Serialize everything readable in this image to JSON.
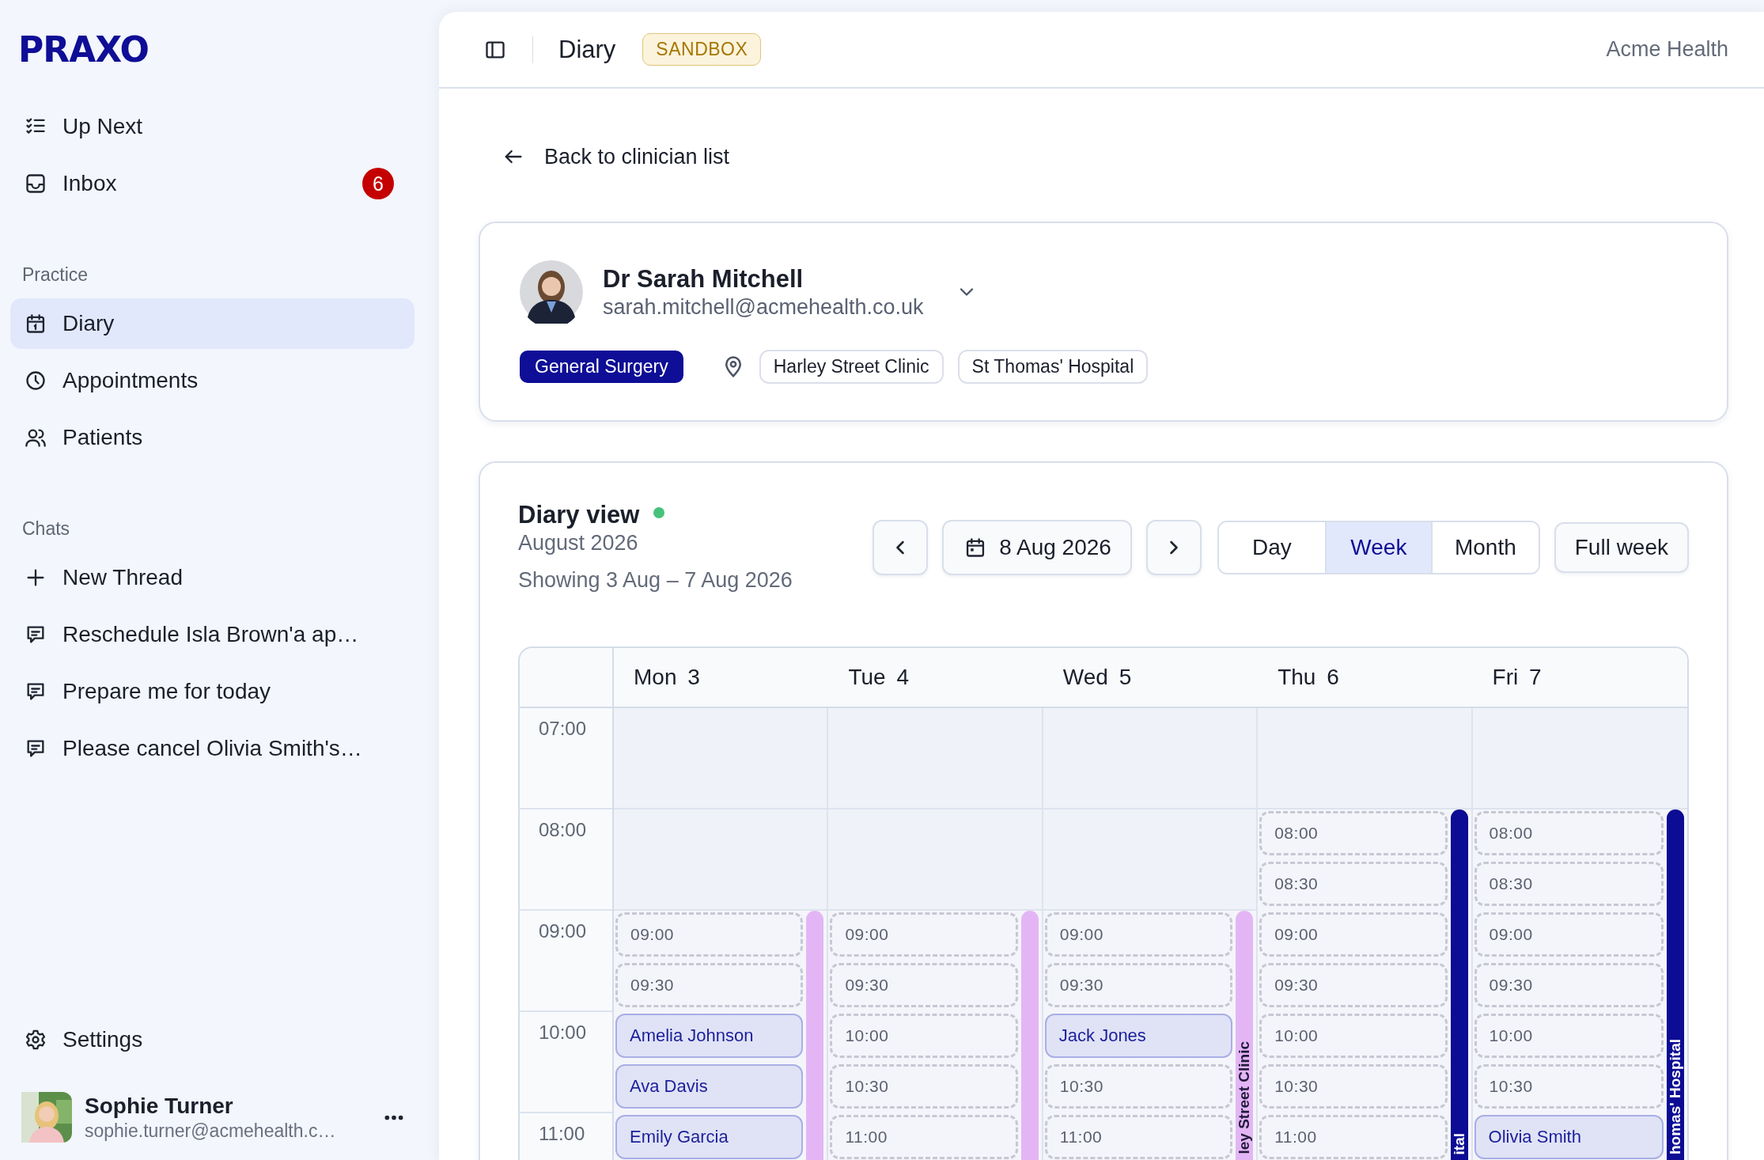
{
  "sidebar": {
    "logo": "PRAXO",
    "nav": [
      {
        "label": "Up Next",
        "kind": "checklist",
        "selected": false
      },
      {
        "label": "Inbox",
        "kind": "inbox",
        "badge": "6",
        "selected": false
      }
    ],
    "sections": [
      {
        "title": "Practice",
        "items": [
          {
            "label": "Diary",
            "kind": "calendar",
            "selected": true
          },
          {
            "label": "Appointments",
            "kind": "clock",
            "selected": false
          },
          {
            "label": "Patients",
            "kind": "users",
            "selected": false
          }
        ]
      },
      {
        "title": "Chats",
        "items": [
          {
            "label": "New Thread",
            "kind": "new",
            "selected": false
          },
          {
            "label": "Reschedule Isla Brown'a ap…",
            "kind": "chat",
            "selected": false
          },
          {
            "label": "Prepare me for today",
            "kind": "chat",
            "selected": false
          },
          {
            "label": "Please cancel Olivia Smith's…",
            "kind": "chat",
            "selected": false
          }
        ]
      }
    ],
    "settings": {
      "label": "Settings"
    },
    "user": {
      "name": "Sophie Turner",
      "email": "sophie.turner@acmehealth.c…"
    }
  },
  "header": {
    "title": "Diary",
    "badge": "SANDBOX",
    "org": "Acme Health"
  },
  "back_link": "Back to clinician list",
  "clinician": {
    "name": "Dr Sarah Mitchell",
    "email": "sarah.mitchell@acmehealth.co.uk",
    "specialty": "General Surgery",
    "locations": [
      "Harley Street Clinic",
      "St Thomas' Hospital"
    ]
  },
  "diary": {
    "title": "Diary view",
    "live": true,
    "month": "August 2026",
    "range": "Showing 3 Aug – 7 Aug 2026",
    "date": "8 Aug 2026",
    "views": [
      {
        "label": "Day",
        "selected": false
      },
      {
        "label": "Week",
        "selected": true
      },
      {
        "label": "Month",
        "selected": false
      }
    ],
    "full_week": "Full week",
    "hours": [
      "07:00",
      "08:00",
      "09:00",
      "10:00",
      "11:00"
    ],
    "days": [
      {
        "label": "Mon 3",
        "location_bar": {
          "color": "#e4b5f5"
        },
        "slots": [
          {
            "kind": "closed"
          },
          {
            "kind": "closed"
          },
          {
            "kind": "closed"
          },
          {
            "kind": "closed"
          },
          {
            "kind": "open",
            "time": "09:00"
          },
          {
            "kind": "open",
            "time": "09:30"
          },
          {
            "kind": "booked",
            "patient": "Amelia Johnson"
          },
          {
            "kind": "booked",
            "patient": "Ava Davis"
          },
          {
            "kind": "booked",
            "patient": "Emily Garcia"
          }
        ]
      },
      {
        "label": "Tue 4",
        "location_bar": {
          "color": "#e4b5f5"
        },
        "slots": [
          {
            "kind": "closed"
          },
          {
            "kind": "closed"
          },
          {
            "kind": "closed"
          },
          {
            "kind": "closed"
          },
          {
            "kind": "open",
            "time": "09:00"
          },
          {
            "kind": "open",
            "time": "09:30"
          },
          {
            "kind": "open",
            "time": "10:00"
          },
          {
            "kind": "open",
            "time": "10:30"
          },
          {
            "kind": "open",
            "time": "11:00"
          }
        ]
      },
      {
        "label": "Wed 5",
        "location_bar": {
          "color": "#e4b5f5",
          "label": "ley Street Clinic"
        },
        "slots": [
          {
            "kind": "closed"
          },
          {
            "kind": "closed"
          },
          {
            "kind": "closed"
          },
          {
            "kind": "closed"
          },
          {
            "kind": "open",
            "time": "09:00"
          },
          {
            "kind": "open",
            "time": "09:30"
          },
          {
            "kind": "booked",
            "patient": "Jack Jones"
          },
          {
            "kind": "open",
            "time": "10:30"
          },
          {
            "kind": "open",
            "time": "11:00"
          }
        ]
      },
      {
        "label": "Thu 6",
        "location_bar": {
          "color": "#0c0c94",
          "label": "ital"
        },
        "slots": [
          {
            "kind": "closed"
          },
          {
            "kind": "closed"
          },
          {
            "kind": "open",
            "time": "08:00"
          },
          {
            "kind": "open",
            "time": "08:30"
          },
          {
            "kind": "open",
            "time": "09:00"
          },
          {
            "kind": "open",
            "time": "09:30"
          },
          {
            "kind": "open",
            "time": "10:00"
          },
          {
            "kind": "open",
            "time": "10:30"
          },
          {
            "kind": "open",
            "time": "11:00"
          }
        ]
      },
      {
        "label": "Fri 7",
        "location_bar": {
          "color": "#0c0c94",
          "label": "homas' Hospital"
        },
        "slots": [
          {
            "kind": "closed"
          },
          {
            "kind": "closed"
          },
          {
            "kind": "open",
            "time": "08:00"
          },
          {
            "kind": "open",
            "time": "08:30"
          },
          {
            "kind": "open",
            "time": "09:00"
          },
          {
            "kind": "open",
            "time": "09:30"
          },
          {
            "kind": "open",
            "time": "10:00"
          },
          {
            "kind": "open",
            "time": "10:30"
          },
          {
            "kind": "booked",
            "patient": "Olivia Smith"
          }
        ]
      }
    ]
  }
}
